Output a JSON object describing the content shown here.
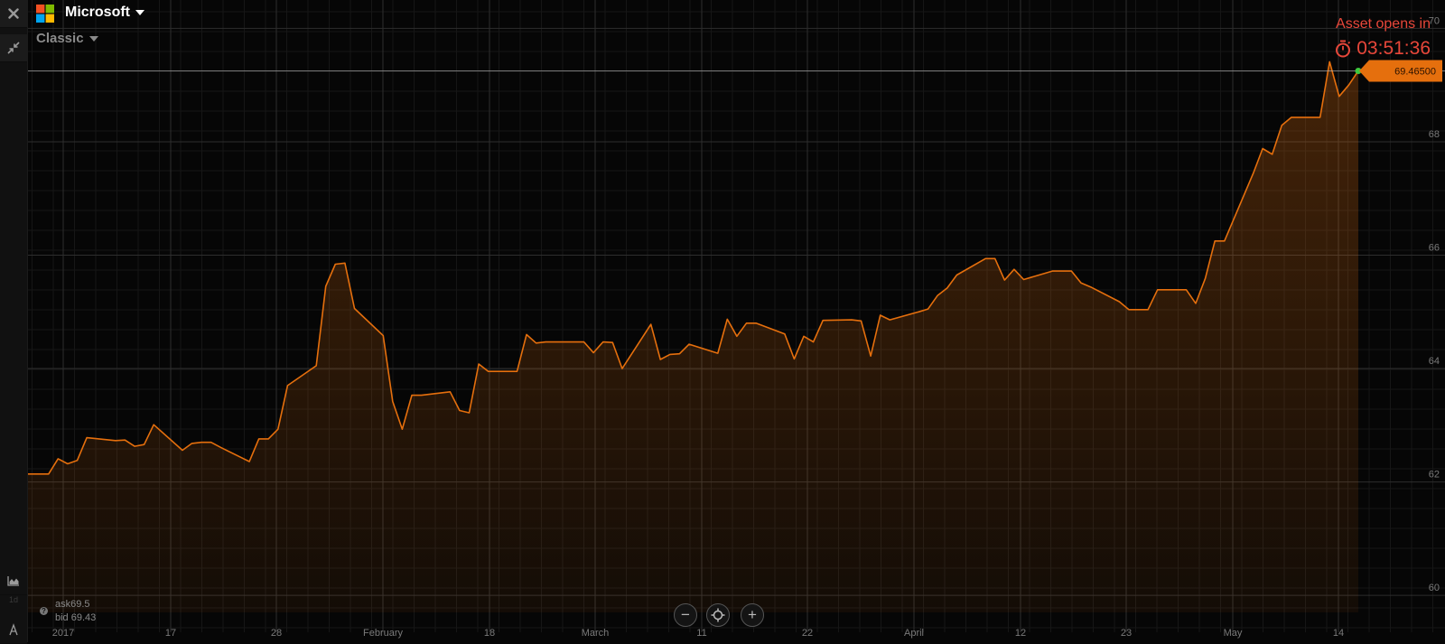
{
  "asset": {
    "name": "Microsoft",
    "logo_colors": [
      "#f25022",
      "#7fba00",
      "#00a4ef",
      "#ffb900"
    ]
  },
  "chart_type_selector": "Classic",
  "toolbar": {
    "close_icon": "close-icon",
    "collapse_icon": "collapse-arrows-icon",
    "area_chart_icon": "area-chart-icon",
    "period_label": "1d",
    "draw_tool_icon": "drawing-tool-icon"
  },
  "asset_opens": {
    "label": "Asset opens in",
    "timer": "03:51:36",
    "color": "#e8473a"
  },
  "quotes": {
    "ask": "ask69.5",
    "bid": "bid 69.43"
  },
  "current_price": {
    "label": "69.46500",
    "color": "#e56f0d"
  },
  "zoom_controls": {
    "zoom_out": "−",
    "zoom_in": "+",
    "center_icon": "crosshair-icon"
  },
  "chart_data": {
    "type": "area",
    "line_color": "#e56f0d",
    "grid": true,
    "ylim": [
      59.7,
      70.5
    ],
    "y_ticks": [
      60,
      62,
      64,
      66,
      68,
      70
    ],
    "x_labels": [
      "2017",
      "17",
      "28",
      "February",
      "18",
      "March",
      "11",
      "22",
      "April",
      "12",
      "23",
      "May",
      "14"
    ],
    "x_range": [
      "2016-12-30",
      "2017-05-19"
    ],
    "x": [
      "2016-12-30",
      "2017-01-02",
      "2017-01-03",
      "2017-01-04",
      "2017-01-05",
      "2017-01-06",
      "2017-01-09",
      "2017-01-10",
      "2017-01-11",
      "2017-01-12",
      "2017-01-13",
      "2017-01-16",
      "2017-01-17",
      "2017-01-18",
      "2017-01-19",
      "2017-01-20",
      "2017-01-23",
      "2017-01-24",
      "2017-01-25",
      "2017-01-26",
      "2017-01-27",
      "2017-01-30",
      "2017-01-31",
      "2017-02-01",
      "2017-02-02",
      "2017-02-03",
      "2017-02-06",
      "2017-02-07",
      "2017-02-08",
      "2017-02-09",
      "2017-02-10",
      "2017-02-13",
      "2017-02-14",
      "2017-02-15",
      "2017-02-16",
      "2017-02-17",
      "2017-02-20",
      "2017-02-21",
      "2017-02-22",
      "2017-02-23",
      "2017-02-24",
      "2017-02-27",
      "2017-02-28",
      "2017-03-01",
      "2017-03-02",
      "2017-03-03",
      "2017-03-06",
      "2017-03-07",
      "2017-03-08",
      "2017-03-09",
      "2017-03-10",
      "2017-03-13",
      "2017-03-14",
      "2017-03-15",
      "2017-03-16",
      "2017-03-17",
      "2017-03-20",
      "2017-03-21",
      "2017-03-22",
      "2017-03-23",
      "2017-03-24",
      "2017-03-27",
      "2017-03-28",
      "2017-03-29",
      "2017-03-30",
      "2017-03-31",
      "2017-04-03",
      "2017-04-04",
      "2017-04-05",
      "2017-04-06",
      "2017-04-07",
      "2017-04-10",
      "2017-04-11",
      "2017-04-12",
      "2017-04-13",
      "2017-04-14",
      "2017-04-17",
      "2017-04-18",
      "2017-04-19",
      "2017-04-20",
      "2017-04-21",
      "2017-04-24",
      "2017-04-25",
      "2017-04-26",
      "2017-04-27",
      "2017-04-28",
      "2017-05-01",
      "2017-05-02",
      "2017-05-03",
      "2017-05-04",
      "2017-05-05",
      "2017-05-08",
      "2017-05-09",
      "2017-05-10",
      "2017-05-11",
      "2017-05-12",
      "2017-05-15",
      "2017-05-16",
      "2017-05-17",
      "2017-05-18",
      "2017-05-19"
    ],
    "y": [
      62.14,
      62.14,
      62.41,
      62.32,
      62.38,
      62.78,
      62.73,
      62.74,
      62.63,
      62.66,
      63.01,
      62.56,
      62.68,
      62.7,
      62.7,
      62.61,
      62.36,
      62.76,
      62.76,
      62.93,
      63.7,
      64.05,
      65.45,
      65.84,
      65.86,
      65.06,
      64.58,
      63.42,
      62.93,
      63.53,
      63.53,
      63.59,
      63.26,
      63.22,
      64.08,
      63.95,
      63.95,
      64.6,
      64.45,
      64.47,
      64.47,
      64.47,
      64.28,
      64.47,
      64.46,
      64.0,
      64.78,
      64.16,
      64.25,
      64.26,
      64.43,
      64.27,
      64.87,
      64.57,
      64.8,
      64.8,
      64.61,
      64.17,
      64.57,
      64.47,
      64.85,
      64.86,
      64.84,
      64.22,
      64.94,
      64.86,
      65.0,
      65.05,
      65.29,
      65.42,
      65.65,
      65.94,
      65.94,
      65.56,
      65.75,
      65.57,
      65.72,
      65.72,
      65.72,
      65.51,
      65.44,
      65.18,
      65.04,
      65.04,
      65.04,
      65.39,
      65.39,
      65.15,
      65.59,
      66.25,
      66.25,
      67.44,
      67.88,
      67.78,
      68.29,
      68.43,
      68.43,
      69.41,
      68.8,
      69.0,
      69.25
    ]
  }
}
